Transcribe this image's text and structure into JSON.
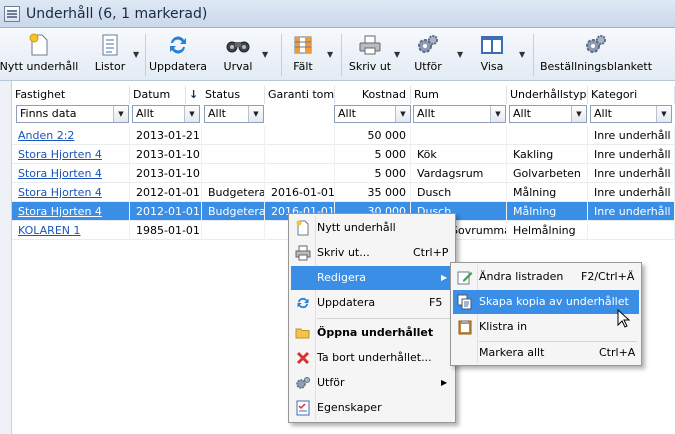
{
  "window": {
    "title": "Underhåll (6, 1 markerad)"
  },
  "toolbar": {
    "new": "Nytt underhåll",
    "lists": "Listor",
    "refresh": "Uppdatera",
    "selection": "Urval",
    "fields": "Fält",
    "print": "Skriv ut",
    "execute": "Utför",
    "view": "Visa",
    "order_form": "Beställningsblankett"
  },
  "columns": {
    "fastighet": "Fastighet",
    "datum": "Datum",
    "status": "Status",
    "garanti": "Garanti tom",
    "kostnad": "Kostnad",
    "rum": "Rum",
    "typ": "Underhållstyp",
    "kategori": "Kategori",
    "sort_icon": "↓"
  },
  "filters": {
    "fastighet": "Finns data",
    "datum": "Allt",
    "status": "Allt",
    "kostnad": "Allt",
    "rum": "Allt",
    "typ": "Allt",
    "kategori": "Allt"
  },
  "rows": [
    {
      "fastighet": "Anden 2:2",
      "datum": "2013-01-21",
      "status": "",
      "garanti": "",
      "kostnad": "50 000",
      "rum": "",
      "typ": "",
      "kategori": "Inre underhåll"
    },
    {
      "fastighet": "Stora Hjorten 4",
      "datum": "2013-01-10",
      "status": "",
      "garanti": "",
      "kostnad": "5 000",
      "rum": "Kök",
      "typ": "Kakling",
      "kategori": "Inre underhåll"
    },
    {
      "fastighet": "Stora Hjorten 4",
      "datum": "2013-01-10",
      "status": "",
      "garanti": "",
      "kostnad": "5 000",
      "rum": "Vardagsrum",
      "typ": "Golvarbeten",
      "kategori": "Inre underhåll"
    },
    {
      "fastighet": "Stora Hjorten 4",
      "datum": "2012-01-01",
      "status": "Budgeterad",
      "garanti": "2016-01-01",
      "kostnad": "35 000",
      "rum": "Dusch",
      "typ": "Målning",
      "kategori": "Inre underhåll"
    },
    {
      "fastighet": "Stora Hjorten 4",
      "datum": "2012-01-01",
      "status": "Budgeterad",
      "garanti": "2016-01-01",
      "kostnad": "30 000",
      "rum": "Dusch",
      "typ": "Målning",
      "kategori": "Inre underhåll"
    },
    {
      "fastighet": "KOLAREN 1",
      "datum": "1985-01-01",
      "status": "",
      "garanti": "",
      "kostnad": "",
      "rum": "Sovrummare",
      "typ": "Helmålning",
      "kategori": ""
    }
  ],
  "context_menu": {
    "new": "Nytt underhåll",
    "print": "Skriv ut...",
    "print_sc": "Ctrl+P",
    "edit": "Redigera",
    "refresh": "Uppdatera",
    "refresh_sc": "F5",
    "open": "Öppna underhållet",
    "delete": "Ta bort underhållet...",
    "execute": "Utför",
    "properties": "Egenskaper"
  },
  "submenu": {
    "edit_row": "Ändra listraden",
    "edit_row_sc": "F2/Ctrl+Ä",
    "copy": "Skapa kopia av underhållet",
    "paste": "Klistra in",
    "select_all": "Markera allt",
    "select_all_sc": "Ctrl+A"
  },
  "colors": {
    "selection": "#3a8ee6",
    "link": "#1a54b8"
  }
}
